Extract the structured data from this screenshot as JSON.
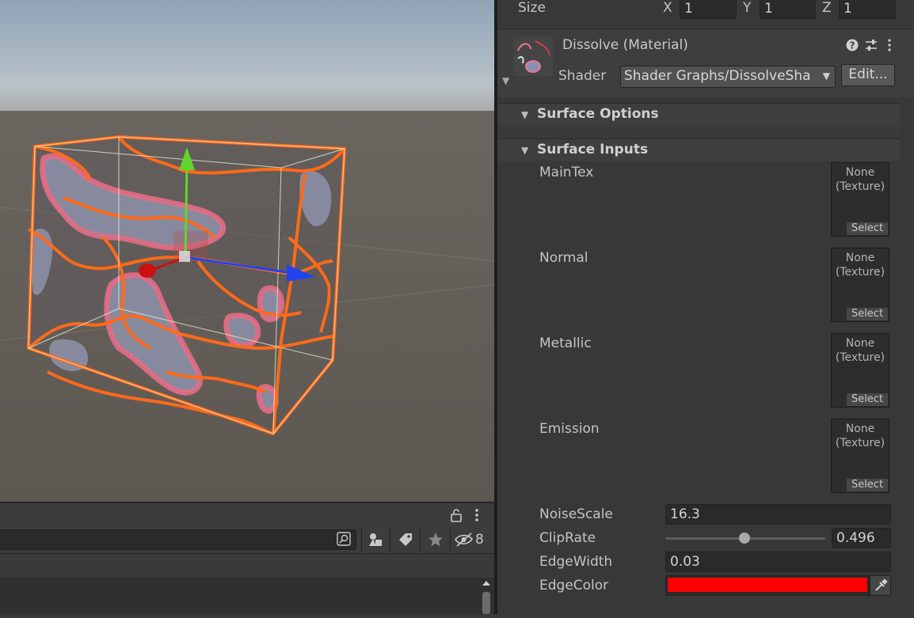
{
  "transform": {
    "size_label": "Size",
    "x_label": "X",
    "x_value": "1",
    "y_label": "Y",
    "y_value": "1",
    "z_label": "Z",
    "z_value": "1"
  },
  "material": {
    "title": "Dissolve (Material)",
    "shader_label": "Shader",
    "shader_value": "Shader Graphs/DissolveSha",
    "edit_label": "Edit..."
  },
  "sections": {
    "surface_options": "Surface Options",
    "surface_inputs": "Surface Inputs"
  },
  "textures": [
    {
      "label": "MainTex",
      "slot_none": "None",
      "slot_type": "(Texture)",
      "select": "Select"
    },
    {
      "label": "Normal",
      "slot_none": "None",
      "slot_type": "(Texture)",
      "select": "Select"
    },
    {
      "label": "Metallic",
      "slot_none": "None",
      "slot_type": "(Texture)",
      "select": "Select"
    },
    {
      "label": "Emission",
      "slot_none": "None",
      "slot_type": "(Texture)",
      "select": "Select"
    }
  ],
  "properties": {
    "noise_scale_label": "NoiseScale",
    "noise_scale_value": "16.3",
    "clip_rate_label": "ClipRate",
    "clip_rate_value": "0.496",
    "edge_width_label": "EdgeWidth",
    "edge_width_value": "0.03",
    "edge_color_label": "EdgeColor",
    "edge_color": "#ff0000"
  },
  "bottom_panel": {
    "hidden_count": "8"
  },
  "colors": {
    "accent_outline": "#ff6a1a",
    "gizmo_y": "#62d42a",
    "gizmo_x": "#2244ee",
    "gizmo_z": "#cc1010"
  },
  "icons": [
    "help-icon",
    "preset-icon",
    "kebab-menu-icon",
    "lock-icon",
    "scene-search-icon",
    "filter-type-icon",
    "label-tag-icon",
    "favorites-star-icon",
    "hidden-eye-icon",
    "eyedropper-icon"
  ]
}
